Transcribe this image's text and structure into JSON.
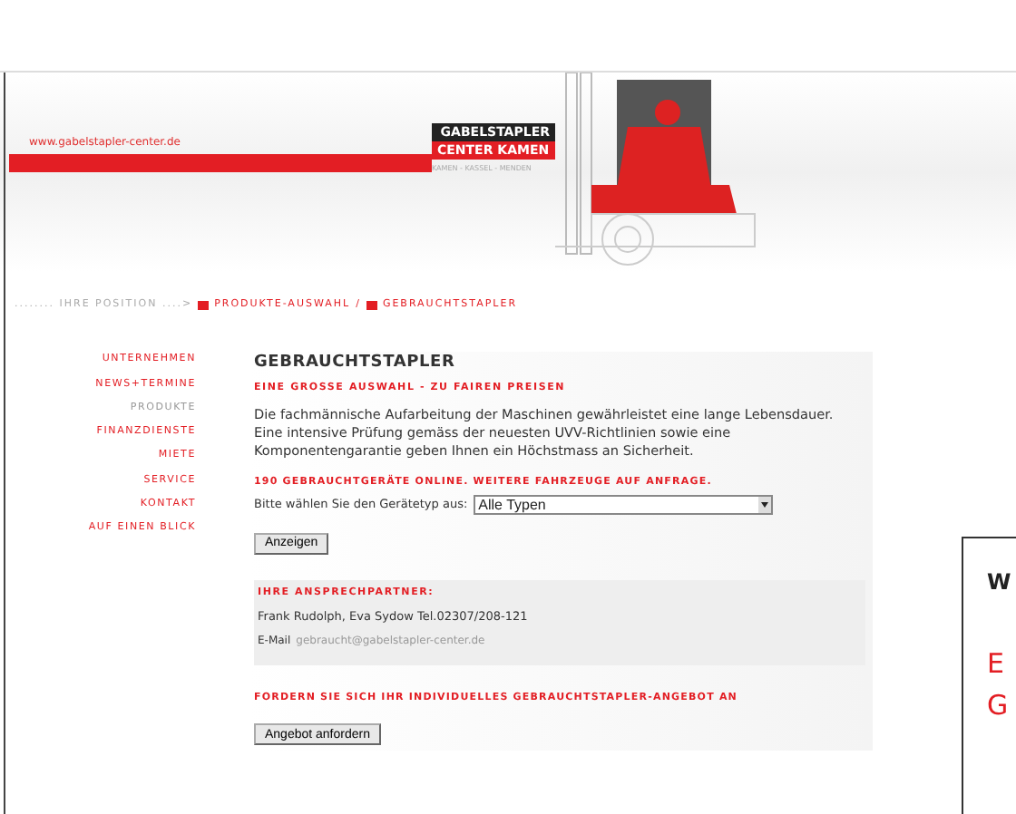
{
  "header": {
    "url": "www.gabelstapler-center.de",
    "logo_top": "GABELSTAPLER",
    "logo_bottom": "CENTER KAMEN",
    "logo_sub": "KAMEN - KASSEL - MENDEN"
  },
  "breadcrumb": {
    "lead": "........ IHRE POSITION ....>",
    "items": [
      {
        "label": "PRODUKTE-AUSWAHL"
      },
      {
        "label": "GEBRAUCHTSTAPLER"
      }
    ],
    "separator": "/"
  },
  "sidebar": {
    "items": [
      {
        "label": "UNTERNEHMEN",
        "selected": false
      },
      {
        "label": "NEWS+TERMINE",
        "selected": false
      },
      {
        "label": "PRODUKTE",
        "selected": true
      },
      {
        "label": "FINANZDIENSTE",
        "selected": false
      },
      {
        "label": "MIETE",
        "selected": false
      },
      {
        "label": "SERVICE",
        "selected": false
      },
      {
        "label": "KONTAKT",
        "selected": false
      },
      {
        "label": "AUF EINEN BLICK",
        "selected": false
      }
    ]
  },
  "content": {
    "title": "GEBRAUCHTSTAPLER",
    "subtitle": "EINE GROSSE AUSWAHL - ZU FAIREN PREISEN",
    "paragraph": "Die fachmännische Aufarbeitung der Maschinen gewährleistet eine lange Lebensdauer. Eine intensive Prüfung gemäss der neuesten UVV-Richtlinien sowie eine Komponentengarantie geben Ihnen ein Höchstmass an Sicherheit.",
    "online_heading": "190 GEBRAUCHTGERÄTE ONLINE. WEITERE FAHRZEUGE AUF ANFRAGE.",
    "select_label": "Bitte wählen Sie den Gerätetyp aus:",
    "select_value": "Alle Typen",
    "show_button": "Anzeigen",
    "contact_heading": "IHRE ANSPRECHPARTNER:",
    "contact_names": "Frank Rudolph, Eva Sydow Tel.02307/208-121",
    "email_label": "E-Mail",
    "email": "gebraucht@gabelstapler-center.de",
    "offer_heading": "FORDERN SIE SICH IHR INDIVIDUELLES GEBRAUCHTSTAPLER-ANGEBOT AN",
    "offer_button": "Angebot anfordern"
  },
  "overlay": {
    "title": "W",
    "lines": [
      "E",
      "G"
    ]
  }
}
